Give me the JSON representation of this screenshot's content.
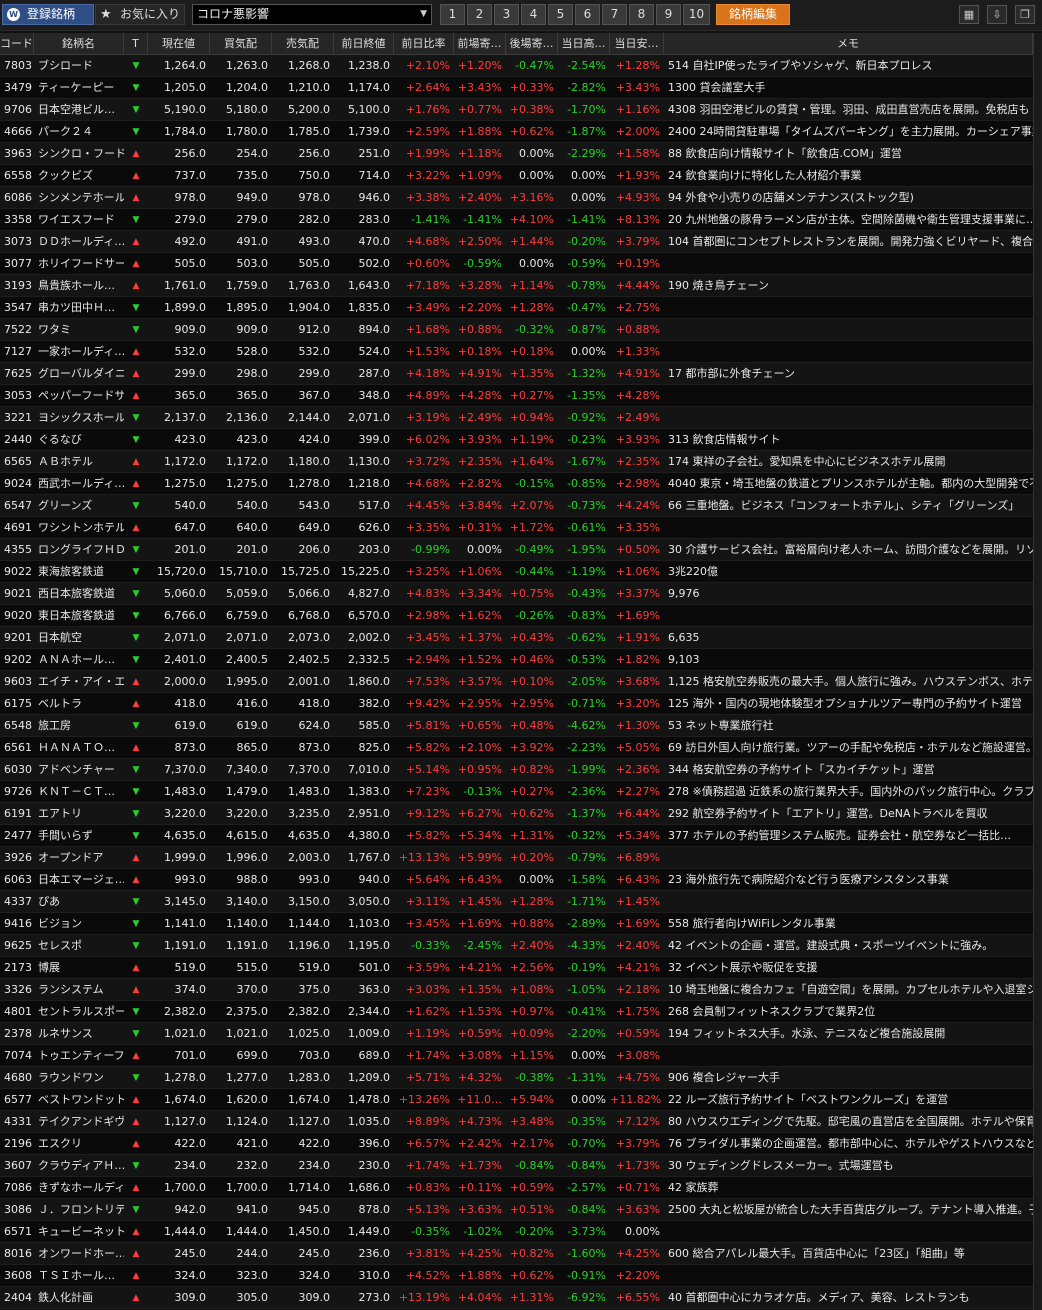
{
  "toolbar": {
    "registered_tab": "登録銘柄",
    "favorites_tab": "お気に入り",
    "list_name": "コロナ悪影響",
    "pages": [
      "1",
      "2",
      "3",
      "4",
      "5",
      "6",
      "7",
      "8",
      "9",
      "10"
    ],
    "edit_button": "銘柄編集",
    "colors": {
      "accent": "#2f4e86",
      "edit": "#d9741c",
      "up": "#ff3d3d",
      "down": "#29d229"
    }
  },
  "headers": [
    "コード",
    "銘柄名",
    "T",
    "現在値",
    "買気配",
    "売気配",
    "前日終値",
    "前日比率",
    "前場寄…",
    "後場寄…",
    "当日高…",
    "当日安…",
    "メモ"
  ],
  "rows": [
    [
      "7803",
      "ブシロード",
      "down",
      "1,264.0",
      "1,263.0",
      "1,268.0",
      "1,238.0",
      "+2.10%",
      "+1.20%",
      "-0.47%",
      "-2.54%",
      "+1.28%",
      "514 自社IP使ったライブやソシャゲ、新日本プロレス"
    ],
    [
      "3479",
      "ティーケーピー",
      "down",
      "1,205.0",
      "1,204.0",
      "1,210.0",
      "1,174.0",
      "+2.64%",
      "+3.43%",
      "+0.33%",
      "-2.82%",
      "+3.43%",
      "1300 貸会議室大手"
    ],
    [
      "9706",
      "日本空港ビル…",
      "down",
      "5,190.0",
      "5,180.0",
      "5,200.0",
      "5,100.0",
      "+1.76%",
      "+0.77%",
      "+0.38%",
      "-1.70%",
      "+1.16%",
      "4308 羽田空港ビルの賃貸・管理。羽田、成田直営売店を展開。免税店も"
    ],
    [
      "4666",
      "パーク２４",
      "down",
      "1,784.0",
      "1,780.0",
      "1,785.0",
      "1,739.0",
      "+2.59%",
      "+1.88%",
      "+0.62%",
      "-1.87%",
      "+2.00%",
      "2400 24時間貸駐車場「タイムズパーキング」を主力展開。カーシェア事業も成長"
    ],
    [
      "3963",
      "シンクロ・フード",
      "up",
      "256.0",
      "254.0",
      "256.0",
      "251.0",
      "+1.99%",
      "+1.18%",
      "0.00%",
      "-2.29%",
      "+1.58%",
      "88 飲食店向け情報サイト「飲食店.COM」運営"
    ],
    [
      "6558",
      "クックビズ",
      "up",
      "737.0",
      "735.0",
      "750.0",
      "714.0",
      "+3.22%",
      "+1.09%",
      "0.00%",
      "0.00%",
      "+1.93%",
      "24 飲食業向けに特化した人材紹介事業"
    ],
    [
      "6086",
      "シンメンテホール…",
      "up",
      "978.0",
      "949.0",
      "978.0",
      "946.0",
      "+3.38%",
      "+2.40%",
      "+3.16%",
      "0.00%",
      "+4.93%",
      "94 外食や小売りの店舗メンテナンス(ストック型)"
    ],
    [
      "3358",
      "ワイエスフード",
      "down",
      "279.0",
      "279.0",
      "282.0",
      "283.0",
      "-1.41%",
      "-1.41%",
      "+4.10%",
      "-1.41%",
      "+8.13%",
      "20 九州地盤の豚骨ラーメン店が主体。空間除菌機や衛生管理支援事業に…"
    ],
    [
      "3073",
      "ＤＤホールディ…",
      "up",
      "492.0",
      "491.0",
      "493.0",
      "470.0",
      "+4.68%",
      "+2.50%",
      "+1.44%",
      "-0.20%",
      "+3.79%",
      "104 首都圏にコンセプトレストランを展開。開発力強くビリヤード、複合カフェ、ウ…"
    ],
    [
      "3077",
      "ホリイフードサー…",
      "up",
      "505.0",
      "503.0",
      "505.0",
      "502.0",
      "+0.60%",
      "-0.59%",
      "0.00%",
      "-0.59%",
      "+0.19%",
      ""
    ],
    [
      "3193",
      "鳥貴族ホール…",
      "up",
      "1,761.0",
      "1,759.0",
      "1,763.0",
      "1,643.0",
      "+7.18%",
      "+3.28%",
      "+1.14%",
      "-0.78%",
      "+4.44%",
      "190 焼き鳥チェーン"
    ],
    [
      "3547",
      "串カツ田中Ｈ…",
      "down",
      "1,899.0",
      "1,895.0",
      "1,904.0",
      "1,835.0",
      "+3.49%",
      "+2.20%",
      "+1.28%",
      "-0.47%",
      "+2.75%",
      ""
    ],
    [
      "7522",
      "ワタミ",
      "down",
      "909.0",
      "909.0",
      "912.0",
      "894.0",
      "+1.68%",
      "+0.88%",
      "-0.32%",
      "-0.87%",
      "+0.88%",
      ""
    ],
    [
      "7127",
      "一家ホールディ…",
      "up",
      "532.0",
      "528.0",
      "532.0",
      "524.0",
      "+1.53%",
      "+0.18%",
      "+0.18%",
      "0.00%",
      "+1.33%",
      ""
    ],
    [
      "7625",
      "グローバルダイニ…",
      "up",
      "299.0",
      "298.0",
      "299.0",
      "287.0",
      "+4.18%",
      "+4.91%",
      "+1.35%",
      "-1.32%",
      "+4.91%",
      "17 都市部に外食チェーン"
    ],
    [
      "3053",
      "ペッパーフードサ…",
      "up",
      "365.0",
      "365.0",
      "367.0",
      "348.0",
      "+4.89%",
      "+4.28%",
      "+0.27%",
      "-1.35%",
      "+4.28%",
      ""
    ],
    [
      "3221",
      "ヨシックスホール…",
      "down",
      "2,137.0",
      "2,136.0",
      "2,144.0",
      "2,071.0",
      "+3.19%",
      "+2.49%",
      "+0.94%",
      "-0.92%",
      "+2.49%",
      ""
    ],
    [
      "2440",
      "ぐるなび",
      "down",
      "423.0",
      "423.0",
      "424.0",
      "399.0",
      "+6.02%",
      "+3.93%",
      "+1.19%",
      "-0.23%",
      "+3.93%",
      "313 飲食店情報サイト"
    ],
    [
      "6565",
      "ＡＢホテル",
      "up",
      "1,172.0",
      "1,172.0",
      "1,180.0",
      "1,130.0",
      "+3.72%",
      "+2.35%",
      "+1.64%",
      "-1.67%",
      "+2.35%",
      "174 東祥の子会社。愛知県を中心にビジネスホテル展開"
    ],
    [
      "9024",
      "西武ホールディ…",
      "up",
      "1,275.0",
      "1,275.0",
      "1,278.0",
      "1,218.0",
      "+4.68%",
      "+2.82%",
      "-0.15%",
      "-0.85%",
      "+2.98%",
      "4040 東京・埼玉地盤の鉄道とプリンスホテルが主軸。都内の大型開発で不動…"
    ],
    [
      "6547",
      "グリーンズ",
      "down",
      "540.0",
      "540.0",
      "543.0",
      "517.0",
      "+4.45%",
      "+3.84%",
      "+2.07%",
      "-0.73%",
      "+4.24%",
      "66 三重地盤。ビジネス「コンフォートホテル」、シティ「グリーンズ」"
    ],
    [
      "4691",
      "ワシントンホテル",
      "up",
      "647.0",
      "640.0",
      "649.0",
      "626.0",
      "+3.35%",
      "+0.31%",
      "+1.72%",
      "-0.61%",
      "+3.35%",
      ""
    ],
    [
      "4355",
      "ロングライフＨＤ",
      "down",
      "201.0",
      "201.0",
      "206.0",
      "203.0",
      "-0.99%",
      "0.00%",
      "-0.49%",
      "-1.95%",
      "+0.50%",
      "30 介護サービス会社。富裕層向け老人ホーム、訪問介護などを展開。リゾート…"
    ],
    [
      "9022",
      "東海旅客鉄道",
      "down",
      "15,720.0",
      "15,710.0",
      "15,725.0",
      "15,225.0",
      "+3.25%",
      "+1.06%",
      "-0.44%",
      "-1.19%",
      "+1.06%",
      "3兆220億"
    ],
    [
      "9021",
      "西日本旅客鉄道",
      "down",
      "5,060.0",
      "5,059.0",
      "5,066.0",
      "4,827.0",
      "+4.83%",
      "+3.34%",
      "+0.75%",
      "-0.43%",
      "+3.37%",
      "9,976"
    ],
    [
      "9020",
      "東日本旅客鉄道",
      "down",
      "6,766.0",
      "6,759.0",
      "6,768.0",
      "6,570.0",
      "+2.98%",
      "+1.62%",
      "-0.26%",
      "-0.83%",
      "+1.69%",
      ""
    ],
    [
      "9201",
      "日本航空",
      "down",
      "2,071.0",
      "2,071.0",
      "2,073.0",
      "2,002.0",
      "+3.45%",
      "+1.37%",
      "+0.43%",
      "-0.62%",
      "+1.91%",
      "6,635"
    ],
    [
      "9202",
      "ＡＮＡホール…",
      "down",
      "2,401.0",
      "2,400.5",
      "2,402.5",
      "2,332.5",
      "+2.94%",
      "+1.52%",
      "+0.46%",
      "-0.53%",
      "+1.82%",
      "9,103"
    ],
    [
      "9603",
      "エイチ・アイ・エス",
      "up",
      "2,000.0",
      "1,995.0",
      "2,001.0",
      "1,860.0",
      "+7.53%",
      "+3.57%",
      "+0.10%",
      "-2.05%",
      "+3.68%",
      "1,125 格安航空券販売の最大手。個人旅行に強み。ハウステンボス、ホテルの…"
    ],
    [
      "6175",
      "ベルトラ",
      "up",
      "418.0",
      "416.0",
      "418.0",
      "382.0",
      "+9.42%",
      "+2.95%",
      "+2.95%",
      "-0.71%",
      "+3.20%",
      "125 海外・国内の現地体験型オプショナルツアー専門の予約サイト運営"
    ],
    [
      "6548",
      "旅工房",
      "down",
      "619.0",
      "619.0",
      "624.0",
      "585.0",
      "+5.81%",
      "+0.65%",
      "+0.48%",
      "-4.62%",
      "+1.30%",
      "53 ネット専業旅行社"
    ],
    [
      "6561",
      "ＨＡＮＡＴＯ…",
      "up",
      "873.0",
      "865.0",
      "873.0",
      "825.0",
      "+5.82%",
      "+2.10%",
      "+3.92%",
      "-2.23%",
      "+5.05%",
      "69 訪日外国人向け旅行業。ツアーの手配や免税店・ホテルなど施設運営。韓…"
    ],
    [
      "6030",
      "アドベンチャー",
      "down",
      "7,370.0",
      "7,340.0",
      "7,370.0",
      "7,010.0",
      "+5.14%",
      "+0.95%",
      "+0.82%",
      "-1.99%",
      "+2.36%",
      "344 格安航空券の予約サイト「スカイチケット」運営"
    ],
    [
      "9726",
      "ＫＮＴ－ＣＴ…",
      "down",
      "1,483.0",
      "1,479.0",
      "1,483.0",
      "1,383.0",
      "+7.23%",
      "-0.13%",
      "+0.27%",
      "-2.36%",
      "+2.27%",
      "278 ※債務超過 近鉄系の旅行業界大手。国内外のパック旅行中心。クラブ…"
    ],
    [
      "6191",
      "エアトリ",
      "down",
      "3,220.0",
      "3,220.0",
      "3,235.0",
      "2,951.0",
      "+9.12%",
      "+6.27%",
      "+0.62%",
      "-1.37%",
      "+6.44%",
      "292 航空券予約サイト「エアトリ」運営。DeNAトラベルを買収"
    ],
    [
      "2477",
      "手間いらず",
      "down",
      "4,635.0",
      "4,615.0",
      "4,635.0",
      "4,380.0",
      "+5.82%",
      "+5.34%",
      "+1.31%",
      "-0.32%",
      "+5.34%",
      "377 ホテルの予約管理システム販売。証券会社・航空券など一括比…"
    ],
    [
      "3926",
      "オープンドア",
      "up",
      "1,999.0",
      "1,996.0",
      "2,003.0",
      "1,767.0",
      "+13.13%",
      "+5.99%",
      "+0.20%",
      "-0.79%",
      "+6.89%",
      ""
    ],
    [
      "6063",
      "日本エマージェ…",
      "up",
      "993.0",
      "988.0",
      "993.0",
      "940.0",
      "+5.64%",
      "+6.43%",
      "0.00%",
      "-1.58%",
      "+6.43%",
      "23 海外旅行先で病院紹介など行う医療アシスタンス事業"
    ],
    [
      "4337",
      "ぴあ",
      "down",
      "3,145.0",
      "3,140.0",
      "3,150.0",
      "3,050.0",
      "+3.11%",
      "+1.45%",
      "+1.28%",
      "-1.71%",
      "+1.45%",
      ""
    ],
    [
      "9416",
      "ビジョン",
      "down",
      "1,141.0",
      "1,140.0",
      "1,144.0",
      "1,103.0",
      "+3.45%",
      "+1.69%",
      "+0.88%",
      "-2.89%",
      "+1.69%",
      "558 旅行者向けWiFiレンタル事業"
    ],
    [
      "9625",
      "セレスポ",
      "down",
      "1,191.0",
      "1,191.0",
      "1,196.0",
      "1,195.0",
      "-0.33%",
      "-2.45%",
      "+2.40%",
      "-4.33%",
      "+2.40%",
      "42 イベントの企画・運営。建設式典・スポーツイベントに強み。"
    ],
    [
      "2173",
      "博展",
      "up",
      "519.0",
      "515.0",
      "519.0",
      "501.0",
      "+3.59%",
      "+4.21%",
      "+2.56%",
      "-0.19%",
      "+4.21%",
      "32 イベント展示や販促を支援"
    ],
    [
      "3326",
      "ランシステム",
      "up",
      "374.0",
      "370.0",
      "375.0",
      "363.0",
      "+3.03%",
      "+1.35%",
      "+1.08%",
      "-1.05%",
      "+2.18%",
      "10 埼玉地盤に複合カフェ「自遊空間」を展開。カプセルホテルや入退室システム…"
    ],
    [
      "4801",
      "セントラルスポーツ",
      "down",
      "2,382.0",
      "2,375.0",
      "2,382.0",
      "2,344.0",
      "+1.62%",
      "+1.53%",
      "+0.97%",
      "-0.41%",
      "+1.75%",
      "268 会員制フィットネスクラブで業界2位"
    ],
    [
      "2378",
      "ルネサンス",
      "down",
      "1,021.0",
      "1,021.0",
      "1,025.0",
      "1,009.0",
      "+1.19%",
      "+0.59%",
      "+0.09%",
      "-2.20%",
      "+0.59%",
      "194 フィットネス大手。水泳、テニスなど複合施設展開"
    ],
    [
      "7074",
      "トゥエンティーフォ…",
      "up",
      "701.0",
      "699.0",
      "703.0",
      "689.0",
      "+1.74%",
      "+3.08%",
      "+1.15%",
      "0.00%",
      "+3.08%",
      ""
    ],
    [
      "4680",
      "ラウンドワン",
      "down",
      "1,278.0",
      "1,277.0",
      "1,283.0",
      "1,209.0",
      "+5.71%",
      "+4.32%",
      "-0.38%",
      "-1.31%",
      "+4.75%",
      "906 複合レジャー大手"
    ],
    [
      "6577",
      "ベストワンドットコム",
      "up",
      "1,674.0",
      "1,620.0",
      "1,674.0",
      "1,478.0",
      "+13.26%",
      "+11.0…",
      "+5.94%",
      "0.00%",
      "+11.82%",
      "22 ルーズ旅行予約サイト「ベストワンクルーズ」を運営"
    ],
    [
      "4331",
      "テイクアンドギヴ…",
      "up",
      "1,127.0",
      "1,124.0",
      "1,127.0",
      "1,035.0",
      "+8.89%",
      "+4.73%",
      "+3.48%",
      "-0.35%",
      "+7.12%",
      "80 ハウスウエディングで先駆。邸宅風の直営店を全国展開。ホテルや保育園も…"
    ],
    [
      "2196",
      "エスクリ",
      "up",
      "422.0",
      "421.0",
      "422.0",
      "396.0",
      "+6.57%",
      "+2.42%",
      "+2.17%",
      "-0.70%",
      "+3.79%",
      "76 ブライダル事業の企画運営。都市部中心に、ホテルやゲストハウスなど業態…"
    ],
    [
      "3607",
      "クラウディアＨ…",
      "down",
      "234.0",
      "232.0",
      "234.0",
      "230.0",
      "+1.74%",
      "+1.73%",
      "-0.84%",
      "-0.84%",
      "+1.73%",
      "30 ウェディングドレスメーカー。式場運営も"
    ],
    [
      "7086",
      "きずなホールディ…",
      "up",
      "1,700.0",
      "1,700.0",
      "1,714.0",
      "1,686.0",
      "+0.83%",
      "+0.11%",
      "+0.59%",
      "-2.57%",
      "+0.71%",
      "42 家族葬"
    ],
    [
      "3086",
      "Ｊ．フロントリテ…",
      "down",
      "942.0",
      "941.0",
      "945.0",
      "878.0",
      "+5.13%",
      "+3.63%",
      "+0.51%",
      "-0.84%",
      "+3.63%",
      "2500 大丸と松坂屋が統合した大手百貨店グループ。テナント導入推進。子会…"
    ],
    [
      "6571",
      "キュービーネット…",
      "up",
      "1,444.0",
      "1,444.0",
      "1,450.0",
      "1,449.0",
      "-0.35%",
      "-1.02%",
      "-0.20%",
      "-3.73%",
      "0.00%",
      ""
    ],
    [
      "8016",
      "オンワードホー…",
      "up",
      "245.0",
      "244.0",
      "245.0",
      "236.0",
      "+3.81%",
      "+4.25%",
      "+0.82%",
      "-1.60%",
      "+4.25%",
      "600 総合アパレル最大手。百貨店中心に「23区」「組曲」等"
    ],
    [
      "3608",
      "ＴＳＩホール…",
      "up",
      "324.0",
      "323.0",
      "324.0",
      "310.0",
      "+4.52%",
      "+1.88%",
      "+0.62%",
      "-0.91%",
      "+2.20%",
      ""
    ],
    [
      "2404",
      "鉄人化計画",
      "up",
      "309.0",
      "305.0",
      "309.0",
      "273.0",
      "+13.19%",
      "+4.04%",
      "+1.31%",
      "-6.92%",
      "+6.55%",
      "40 首都圏中心にカラオケ店。メディア、美容、レストランも"
    ]
  ]
}
